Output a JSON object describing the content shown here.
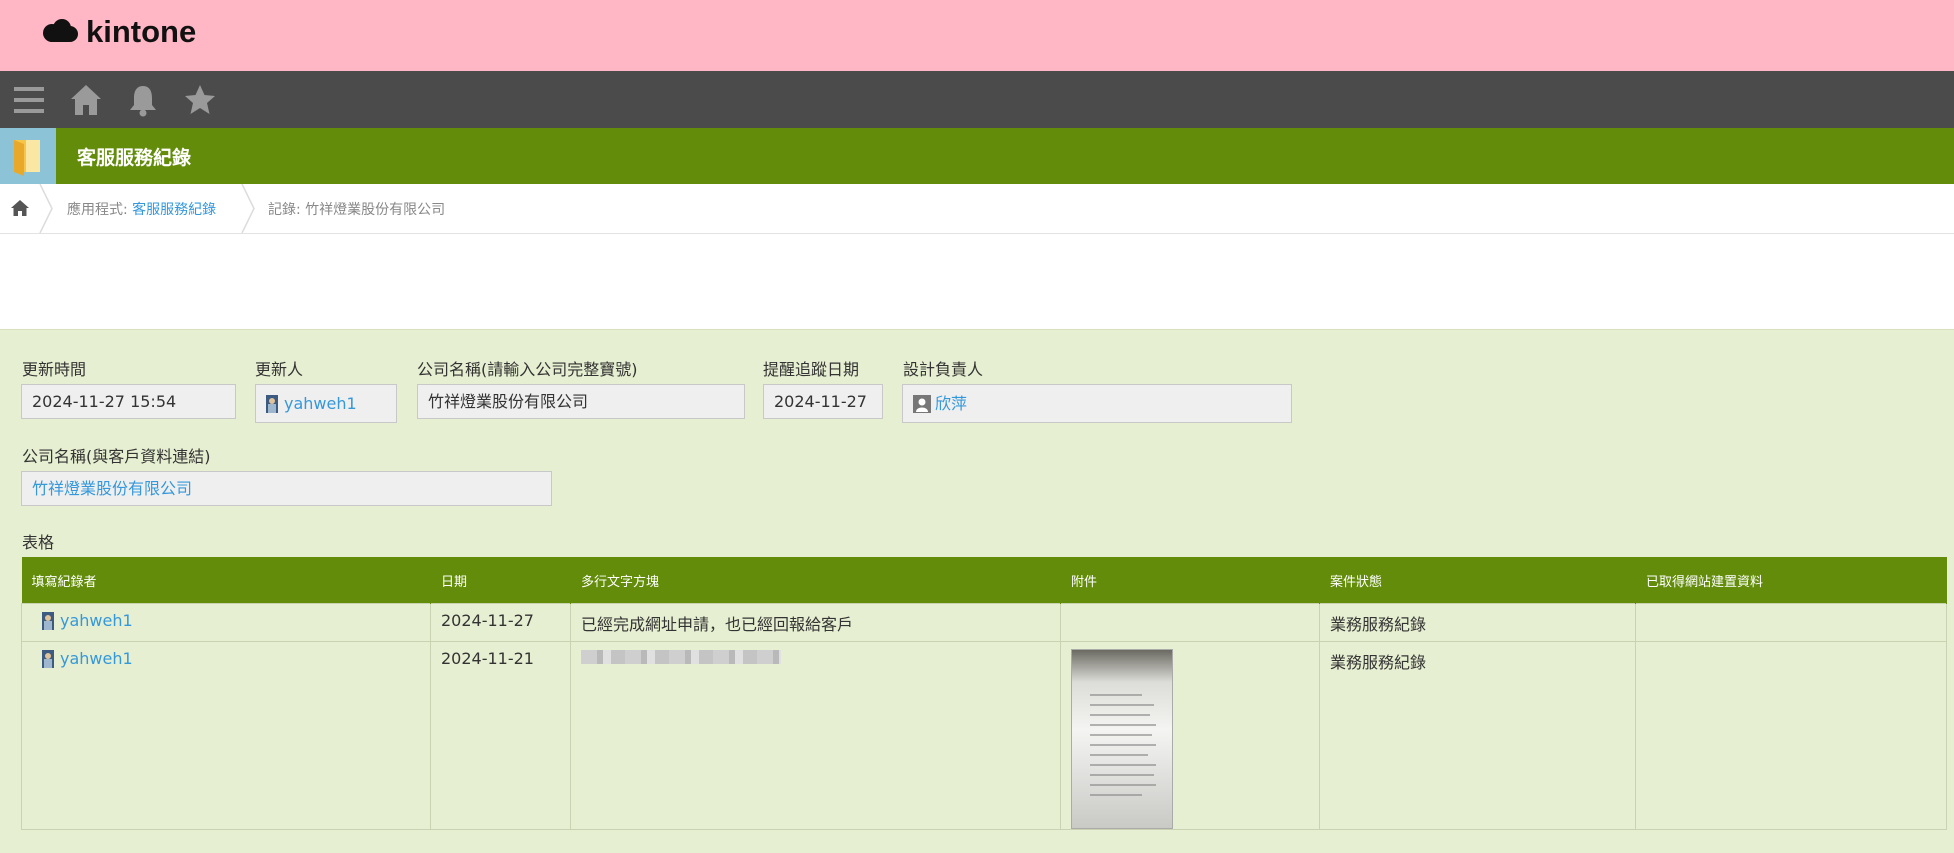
{
  "brand": {
    "name": "kintone"
  },
  "nav": {
    "icons": [
      "menu-icon",
      "home-icon",
      "bell-icon",
      "star-icon"
    ]
  },
  "app": {
    "title": "客服服務紀錄"
  },
  "breadcrumb": {
    "app_prefix": "應用程式: ",
    "app_link": "客服服務紀錄",
    "record_label": "記錄: 竹祥燈業股份有限公司"
  },
  "fields": {
    "updated_time": {
      "label": "更新時間",
      "value": "2024-11-27 15:54"
    },
    "updater": {
      "label": "更新人",
      "value": "yahweh1"
    },
    "company_name": {
      "label": "公司名稱(請輸入公司完整寶號)",
      "value": "竹祥燈業股份有限公司"
    },
    "reminder_date": {
      "label": "提醒追蹤日期",
      "value": "2024-11-27"
    },
    "designer": {
      "label": "設計負責人",
      "value": "欣萍"
    },
    "company_link": {
      "label": "公司名稱(與客戶資料連結)",
      "value": "竹祥燈業股份有限公司"
    }
  },
  "table": {
    "label": "表格",
    "headers": [
      "填寫紀錄者",
      "日期",
      "多行文字方塊",
      "附件",
      "案件狀態",
      "已取得網站建置資料"
    ],
    "rows": [
      {
        "recorder": "yahweh1",
        "date": "2024-11-27",
        "text": "已經完成網址申請，也已經回報給客戶",
        "status": "業務服務紀錄",
        "site_data": ""
      },
      {
        "recorder": "yahweh1",
        "date": "2024-11-21",
        "text": "",
        "status": "業務服務紀錄",
        "site_data": ""
      }
    ]
  },
  "colors": {
    "topbar": "#ffb6c5",
    "navbar": "#4b4b4b",
    "accent": "#628c0a",
    "background": "#e6efd1",
    "link": "#3498db"
  }
}
